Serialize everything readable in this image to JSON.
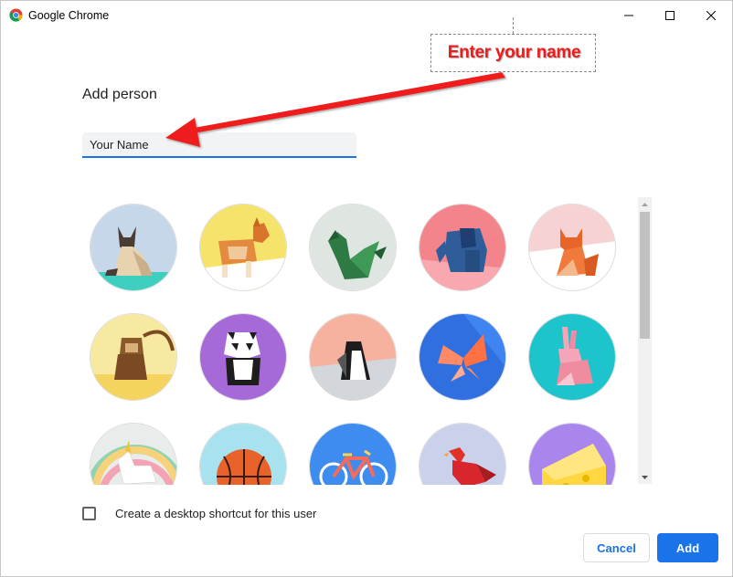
{
  "window": {
    "title": "Google Chrome",
    "icon": "chrome-logo-icon",
    "controls": [
      "minimize-icon",
      "maximize-icon",
      "close-icon"
    ]
  },
  "annotation": {
    "text": "Enter your name",
    "color": "#ee1c1c"
  },
  "dialog": {
    "title": "Add person",
    "name_input": {
      "value": "Your Name"
    },
    "avatars": [
      {
        "name": "origami-cat",
        "bg": "#c7d7ea"
      },
      {
        "name": "origami-corgi",
        "bg": "#f6e36b"
      },
      {
        "name": "origami-dragon",
        "bg": "#dfe6e2"
      },
      {
        "name": "origami-elephant",
        "bg": "#f4848c"
      },
      {
        "name": "origami-fox",
        "bg": "#f6d2d2"
      },
      {
        "name": "origami-monkey",
        "bg": "#f8e9a0"
      },
      {
        "name": "origami-panda",
        "bg": "#a66ad8"
      },
      {
        "name": "origami-penguin",
        "bg": "#f6b29f"
      },
      {
        "name": "origami-butterfly",
        "bg": "#2f6fe0"
      },
      {
        "name": "origami-rabbit",
        "bg": "#1ec4cc"
      },
      {
        "name": "origami-unicorn",
        "bg": "#e8ecea"
      },
      {
        "name": "basketball",
        "bg": "#a8e2ef"
      },
      {
        "name": "bicycle",
        "bg": "#3f8cf1"
      },
      {
        "name": "bird",
        "bg": "#c9d2ea"
      },
      {
        "name": "cheese",
        "bg": "#a986ee"
      }
    ],
    "shortcut_label": "Create a desktop shortcut for this user",
    "shortcut_checked": false,
    "cancel_label": "Cancel",
    "add_label": "Add",
    "accent": "#1a73e8"
  }
}
